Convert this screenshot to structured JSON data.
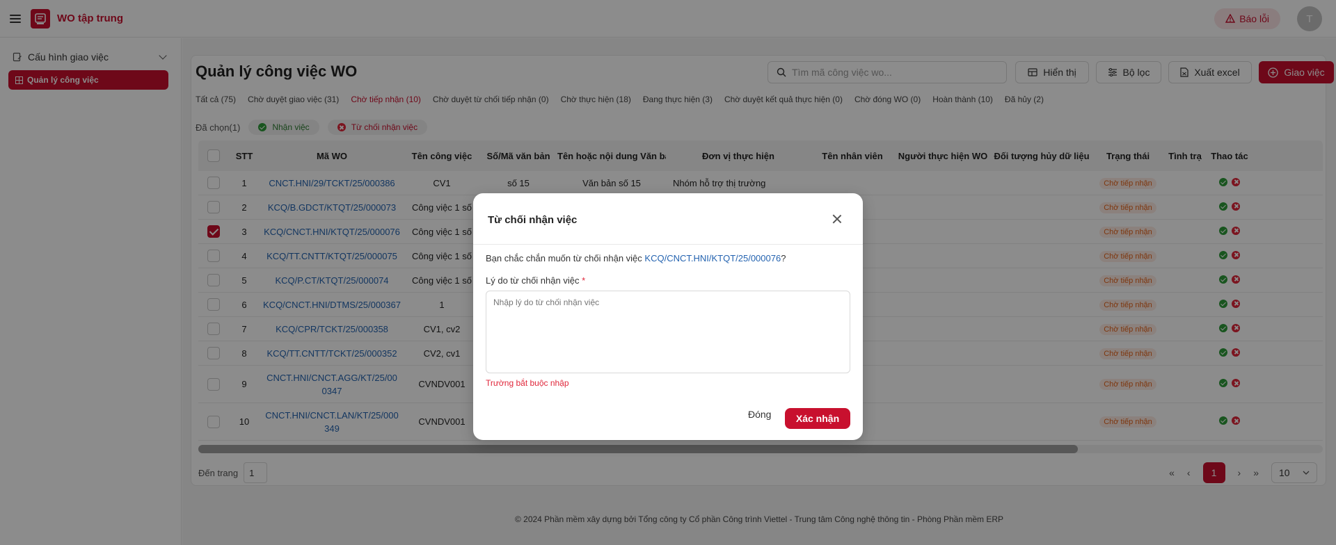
{
  "app": {
    "title": "WO tập trung",
    "report_label": "Báo lỗi",
    "avatar_letter": "T",
    "brand_color": "#c8102e"
  },
  "sidebar": {
    "group_label": "Cấu hình giao việc",
    "items": [
      {
        "label": "Quản lý công việc"
      }
    ]
  },
  "main": {
    "title": "Quản lý công việc WO",
    "search_placeholder": "Tìm mã công việc wo...",
    "buttons": {
      "display": "Hiển thị",
      "filter": "Bộ lọc",
      "export": "Xuất excel",
      "assign": "Giao việc"
    },
    "tabs": [
      {
        "label": "Tất cả (75)"
      },
      {
        "label": "Chờ duyệt giao việc (31)"
      },
      {
        "label": "Chờ tiếp nhận (10)",
        "active": true
      },
      {
        "label": "Chờ duyệt từ chối tiếp nhận (0)"
      },
      {
        "label": "Chờ thực hiện (18)"
      },
      {
        "label": "Đang thực hiện (3)"
      },
      {
        "label": "Chờ duyệt kết quả thực hiện (0)"
      },
      {
        "label": "Chờ đóng WO (0)"
      },
      {
        "label": "Hoàn thành (10)"
      },
      {
        "label": "Đã hủy (2)"
      }
    ],
    "selected_label": "Đã chọn(1)",
    "bulk_accept": "Nhận việc",
    "bulk_reject": "Từ chối nhận việc",
    "columns": [
      "STT",
      "Mã WO",
      "Tên công việc",
      "Số/Mã văn bản",
      "Tên hoặc nội dung Văn bản",
      "Đơn vị thực hiện",
      "Tên nhân viên",
      "Người thực hiện WO",
      "Đối tượng hủy dữ liệu",
      "Trạng thái",
      "Tình trạ",
      "Thao tác"
    ],
    "rows": [
      {
        "stt": "1",
        "code": "CNCT.HNI/29/TCKT/25/000386",
        "name": "CV1",
        "doc_no": "số 15",
        "doc_name": "Văn bản số 15",
        "unit": "Nhóm hỗ trợ thị trường",
        "status": "Chờ tiếp nhận",
        "checked": false
      },
      {
        "stt": "2",
        "code": "KCQ/B.GDCT/KTQT/25/000073",
        "name": "Công việc 1 số",
        "doc_no": "",
        "doc_name": "",
        "unit": "",
        "status": "Chờ tiếp nhận",
        "checked": false
      },
      {
        "stt": "3",
        "code": "KCQ/CNCT.HNI/KTQT/25/000076",
        "name": "Công việc 1 số",
        "doc_no": "",
        "doc_name": "",
        "unit": "",
        "status": "Chờ tiếp nhận",
        "checked": true
      },
      {
        "stt": "4",
        "code": "KCQ/TT.CNTT/KTQT/25/000075",
        "name": "Công việc 1 số",
        "doc_no": "",
        "doc_name": "",
        "unit": "",
        "status": "Chờ tiếp nhận",
        "checked": false
      },
      {
        "stt": "5",
        "code": "KCQ/P.CT/KTQT/25/000074",
        "name": "Công việc 1 số",
        "doc_no": "",
        "doc_name": "",
        "unit": "",
        "status": "Chờ tiếp nhận",
        "checked": false
      },
      {
        "stt": "6",
        "code": "KCQ/CNCT.HNI/DTMS/25/000367",
        "name": "1",
        "doc_no": "",
        "doc_name": "",
        "unit": "",
        "status": "Chờ tiếp nhận",
        "checked": false
      },
      {
        "stt": "7",
        "code": "KCQ/CPR/TCKT/25/000358",
        "name": "CV1, cv2",
        "doc_no": "",
        "doc_name": "",
        "unit": "",
        "status": "Chờ tiếp nhận",
        "checked": false
      },
      {
        "stt": "8",
        "code": "KCQ/TT.CNTT/TCKT/25/000352",
        "name": "CV2, cv1",
        "doc_no": "",
        "doc_name": "",
        "unit": "",
        "status": "Chờ tiếp nhận",
        "checked": false
      },
      {
        "stt": "9",
        "code": "CNCT.HNI/CNCT.AGG/KT/25/000347",
        "name": "CVNDV001",
        "doc_no": "",
        "doc_name": "",
        "unit": "",
        "status": "Chờ tiếp nhận",
        "checked": false
      },
      {
        "stt": "10",
        "code": "CNCT.HNI/CNCT.LAN/KT/25/000349",
        "name": "CVNDV001",
        "doc_no": "",
        "doc_name": "",
        "unit": "",
        "status": "Chờ tiếp nhận",
        "checked": false
      }
    ],
    "goto_label": "Đến trang",
    "goto_value": "1",
    "pagination": {
      "current": "1",
      "page_size": "10"
    }
  },
  "footer": "© 2024 Phần mềm xây dựng bởi Tổng công ty Cổ phần Công trình Viettel - Trung tâm Công nghệ thông tin - Phòng Phần mềm ERP",
  "modal": {
    "title": "Từ chối nhận việc",
    "message_prefix": "Bạn chắc chắn muốn từ chối nhận việc ",
    "message_code": "KCQ/CNCT.HNI/KTQT/25/000076",
    "message_suffix": "?",
    "reason_label": "Lý do từ chối nhận việc",
    "required_mark": "*",
    "reason_placeholder": "Nhập lý do từ chối nhận việc",
    "error": "Trường bắt buộc nhập",
    "cancel_label": "Đóng",
    "confirm_label": "Xác nhận"
  }
}
